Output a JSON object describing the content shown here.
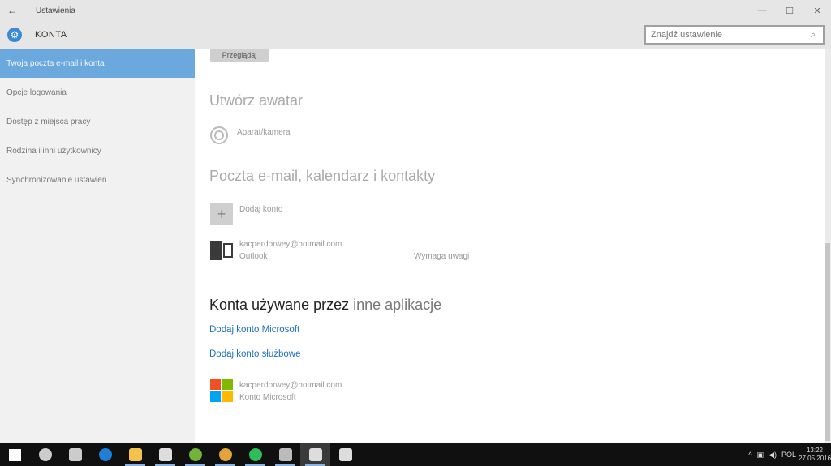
{
  "window": {
    "back_glyph": "←",
    "title": "Ustawienia",
    "minimize_glyph": "—",
    "maximize_glyph": "☐",
    "close_glyph": "✕"
  },
  "header": {
    "section": "KONTA",
    "gear_glyph": "⚙",
    "search_placeholder": "Znajdź ustawienie",
    "search_glyph": "⌕"
  },
  "sidebar": {
    "items": [
      {
        "label": "Twoja poczta e-mail i konta",
        "active": true
      },
      {
        "label": "Opcje logowania",
        "active": false
      },
      {
        "label": "Dostęp z miejsca pracy",
        "active": false
      },
      {
        "label": "Rodzina i inni użytkownicy",
        "active": false
      },
      {
        "label": "Synchronizowanie ustawień",
        "active": false
      }
    ]
  },
  "main": {
    "browse_button": "Przeglądaj",
    "avatar_heading": "Utwórz awatar",
    "camera_label": "Aparat/kamera",
    "mail_heading": "Poczta e-mail, kalendarz i kontakty",
    "add_account_label": "Dodaj konto",
    "outlook_account": {
      "email": "kacperdorwey@hotmail.com",
      "app": "Outlook",
      "status": "Wymaga uwagi"
    },
    "other_apps_heading_a": "Konta używane przez",
    "other_apps_heading_b": " inne aplikacje",
    "link_microsoft": "Dodaj konto Microsoft",
    "link_work": "Dodaj konto służbowe",
    "ms_account": {
      "email": "kacperdorwey@hotmail.com",
      "type": "Konto Microsoft"
    }
  },
  "colors": {
    "accent": "#6aa8dd",
    "link": "#1a6fc2",
    "ms_red": "#f25022",
    "ms_green": "#7fba00",
    "ms_blue": "#00a4ef",
    "ms_yellow": "#ffb900"
  },
  "taskbar": {
    "apps": [
      {
        "name": "start-icon",
        "color": "#ffffff",
        "running": false
      },
      {
        "name": "search-icon",
        "color": "#cccccc",
        "running": false
      },
      {
        "name": "task-view-icon",
        "color": "#cccccc",
        "running": false
      },
      {
        "name": "edge-icon",
        "color": "#1e7fd6",
        "running": false
      },
      {
        "name": "file-explorer-icon",
        "color": "#f2c14e",
        "running": true
      },
      {
        "name": "store-icon",
        "color": "#dddddd",
        "running": true
      },
      {
        "name": "utorrent-icon",
        "color": "#73b33b",
        "running": true
      },
      {
        "name": "chrome-icon",
        "color": "#e4a23a",
        "running": true
      },
      {
        "name": "spotify-icon",
        "color": "#2ebd59",
        "running": true
      },
      {
        "name": "shield-app-icon",
        "color": "#bbbbbb",
        "running": true
      },
      {
        "name": "settings-app-icon",
        "color": "#dddddd",
        "running": true,
        "active": true
      },
      {
        "name": "messaging-icon",
        "color": "#dddddd",
        "running": false
      }
    ],
    "tray_chevron": "^",
    "tray_network": "▣",
    "tray_volume": "◀)",
    "tray_lang": "POL",
    "time": "13:22",
    "date": "27.05.2016"
  }
}
